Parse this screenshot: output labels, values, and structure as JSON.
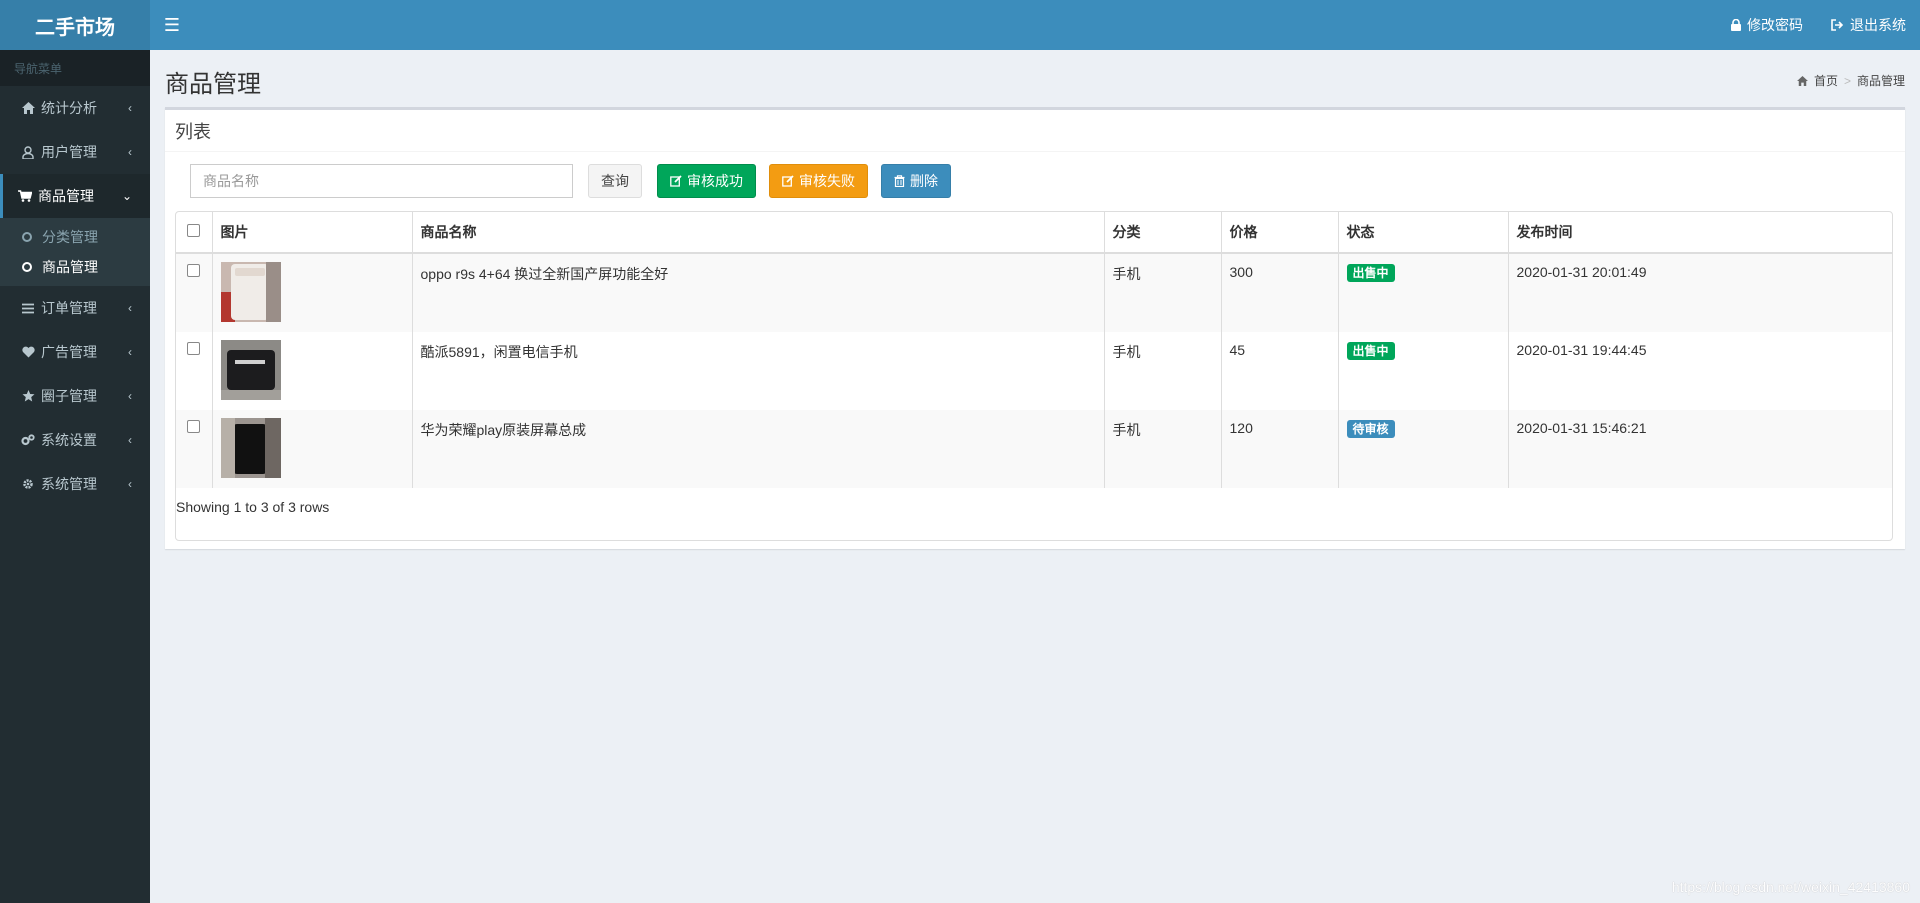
{
  "header": {
    "logo": "二手市场",
    "change_password": "修改密码",
    "logout": "退出系统"
  },
  "sidebar": {
    "nav_header": "导航菜单",
    "items": [
      {
        "label": "统计分析",
        "icon": "home-icon"
      },
      {
        "label": "用户管理",
        "icon": "user-icon"
      },
      {
        "label": "商品管理",
        "icon": "cart-icon",
        "expanded": true
      },
      {
        "label": "订单管理",
        "icon": "list-icon"
      },
      {
        "label": "广告管理",
        "icon": "heart-icon"
      },
      {
        "label": "圈子管理",
        "icon": "star-icon"
      },
      {
        "label": "系统设置",
        "icon": "cogs-icon"
      },
      {
        "label": "系统管理",
        "icon": "gear-icon"
      }
    ],
    "subitems": [
      {
        "label": "分类管理"
      },
      {
        "label": "商品管理",
        "active": true
      }
    ]
  },
  "main": {
    "page_title": "商品管理",
    "breadcrumb": {
      "home": "首页",
      "current": "商品管理"
    },
    "box_title": "列表",
    "search": {
      "placeholder": "商品名称",
      "value": ""
    },
    "buttons": {
      "query": "查询",
      "approve": "审核成功",
      "reject": "审核失败",
      "delete": "删除"
    },
    "table": {
      "columns": [
        "图片",
        "商品名称",
        "分类",
        "价格",
        "状态",
        "发布时间"
      ],
      "rows": [
        {
          "name": "oppo r9s 4+64 换过全新国产屏功能全好",
          "category": "手机",
          "price": "300",
          "status": "出售中",
          "time": "2020-01-31 20:01:49"
        },
        {
          "name": "酷派5891，闲置电信手机",
          "category": "手机",
          "price": "45",
          "status": "出售中",
          "time": "2020-01-31 19:44:45"
        },
        {
          "name": "华为荣耀play原装屏幕总成",
          "category": "手机",
          "price": "120",
          "status": "待审核",
          "time": "2020-01-31 15:46:21"
        }
      ],
      "footer": "Showing 1 to 3 of 3 rows"
    }
  },
  "watermark": "https://blog.csdn.net/weixin_42413860",
  "colors": {
    "header": "#3c8dbc",
    "sidebar": "#222d32",
    "success": "#00a65a",
    "warning": "#f39c12",
    "primary": "#3c8dbc"
  }
}
